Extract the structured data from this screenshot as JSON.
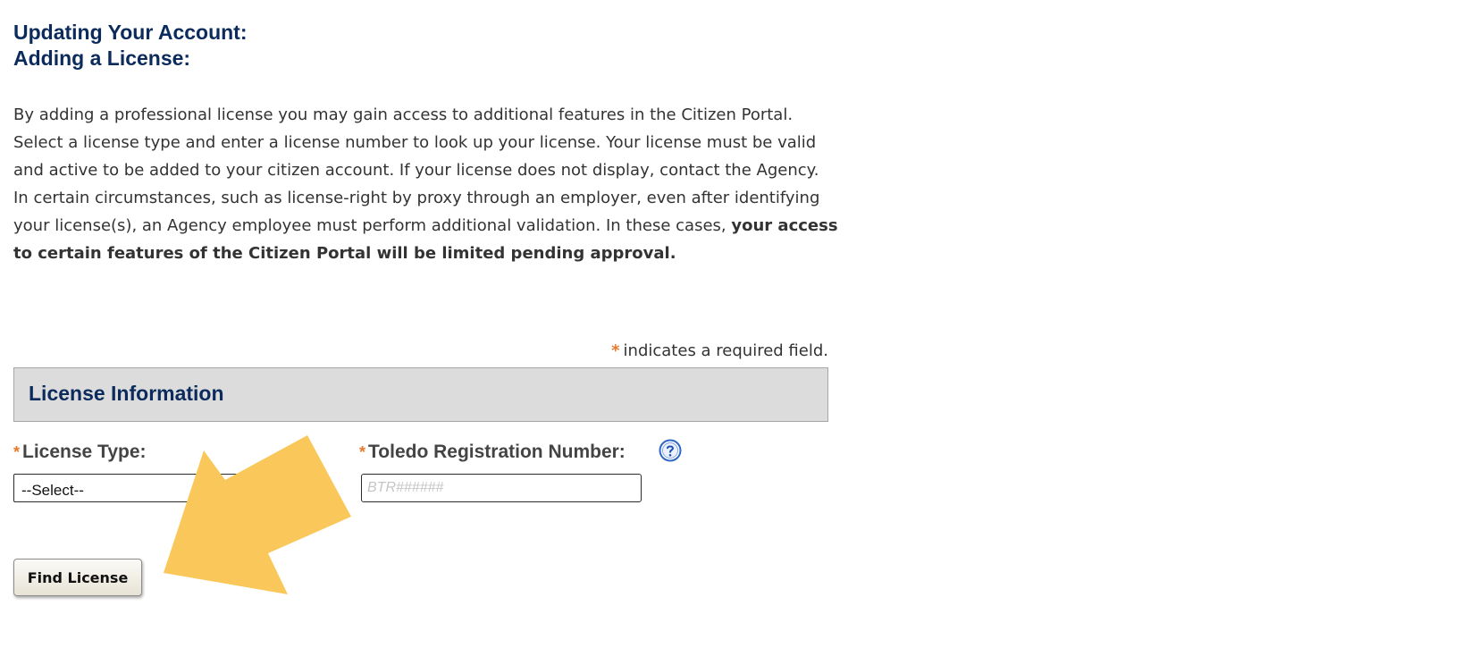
{
  "headings": {
    "line1": "Updating Your Account:",
    "line2": "Adding a License:"
  },
  "intro": {
    "para1": "By adding a professional license you may gain access to additional features in the Citizen Portal. Select a license type and enter a license number to look up your license. Your license must be valid and active to be added to your citizen account. If your license does not display, contact the Agency.",
    "para2_plain": "In certain circumstances, such as license-right by proxy through an employer, even after identifying your license(s), an Agency employee must perform additional validation. In these cases,",
    "para2_bold": "your access to certain features of the Citizen Portal will be limited pending approval."
  },
  "required_note": {
    "star": "*",
    "text": "indicates a required field."
  },
  "section": {
    "title": "License Information"
  },
  "fields": {
    "license_type": {
      "star": "*",
      "label": "License Type:",
      "selected": "--Select--"
    },
    "registration_number": {
      "star": "*",
      "label": "Toledo Registration Number:",
      "value": "",
      "placeholder": "BTR######"
    }
  },
  "buttons": {
    "find_license": "Find License"
  },
  "icons": {
    "help": "help-icon",
    "annotation_arrow": "yellow-arrow-annotation"
  },
  "colors": {
    "heading": "#0b2b5c",
    "required_star": "#e8792d",
    "section_bar": "#dcdcdc",
    "help_icon": "#2f66c8",
    "annotation_arrow": "#fac85a"
  }
}
